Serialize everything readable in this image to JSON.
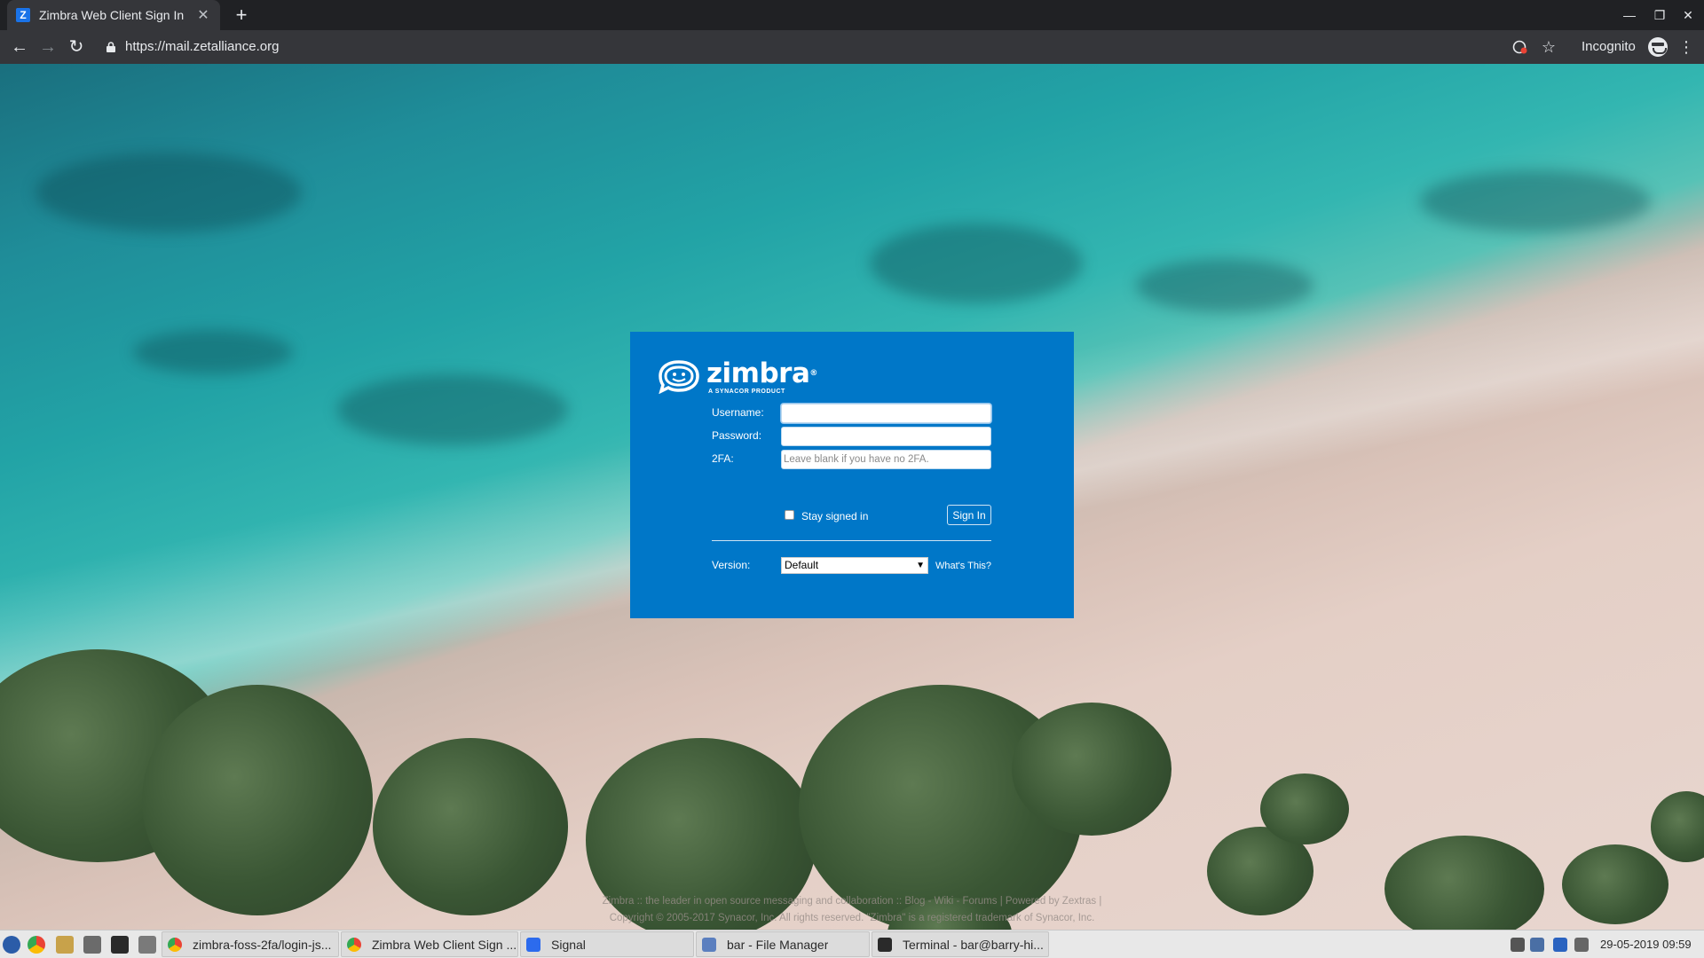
{
  "browser": {
    "tab": {
      "favicon": "Z",
      "title": "Zimbra Web Client Sign In"
    },
    "url": "https://mail.zetalliance.org",
    "incognito_label": "Incognito"
  },
  "login": {
    "logo_word": "zimbra",
    "logo_registered": "®",
    "logo_tagline": "A SYNACOR PRODUCT",
    "username_label": "Username:",
    "password_label": "Password:",
    "twofa_label": "2FA:",
    "twofa_placeholder": "Leave blank if you have no 2FA.",
    "stay_signed_in": "Stay signed in",
    "sign_in": "Sign In",
    "version_label": "Version:",
    "version_value": "Default",
    "whats_this": "What's This?"
  },
  "page_footer": {
    "line1": "Zimbra :: the leader in open source messaging and collaboration :: Blog - Wiki - Forums | Powered by Zextras |",
    "line2": "Copyright © 2005-2017 Synacor, Inc. All rights reserved. \"Zimbra\" is a registered trademark of Synacor, Inc."
  },
  "taskbar": {
    "tasks": [
      {
        "label": "zimbra-foss-2fa/login-js...",
        "icon": "chrome-icon"
      },
      {
        "label": "Zimbra Web Client Sign ...",
        "icon": "chrome-icon"
      },
      {
        "label": "Signal",
        "icon": "signal-icon"
      },
      {
        "label": "bar - File Manager",
        "icon": "folder-icon"
      },
      {
        "label": "Terminal - bar@barry-hi...",
        "icon": "terminal-icon"
      }
    ],
    "clock": "29-05-2019 09:59"
  },
  "colors": {
    "login_panel": "#0077c8",
    "browser_dark": "#202124",
    "browser_toolbar": "#35363a"
  }
}
